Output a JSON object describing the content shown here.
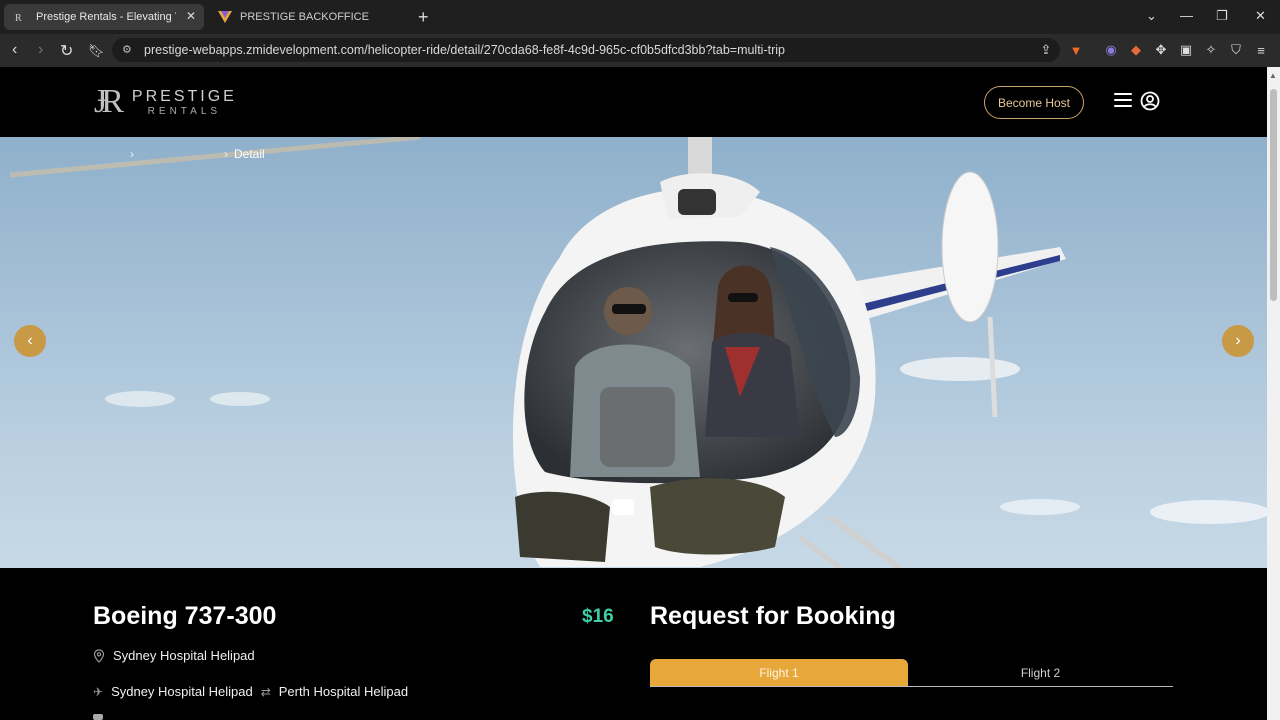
{
  "browser": {
    "tabs": [
      {
        "title": "Prestige Rentals - Elevating Your",
        "favicon": "pr-logo-icon",
        "active": true
      },
      {
        "title": "PRESTIGE BACKOFFICE",
        "favicon": "triangle-logo-icon",
        "active": false
      }
    ],
    "new_tab": "+",
    "url": "prestige-webapps.zmidevelopment.com/helicopter-ride/detail/270cda68-fe8f-4c9d-965c-cf0b5dfcd3bb?tab=multi-trip"
  },
  "header": {
    "logo_mark": "ɈR",
    "logo_word": "PRESTIGE",
    "logo_sub": "RENTALS",
    "become_host": "Become Host"
  },
  "hero": {
    "breadcrumb": {
      "current": "Detail"
    },
    "image": "helicopter-with-pilot-and-passenger"
  },
  "listing": {
    "title": "Boeing 737-300",
    "price": "$16",
    "location": "Sydney Hospital Helipad",
    "route_from": "Sydney Hospital Helipad",
    "route_to": "Perth Hospital Helipad"
  },
  "booking": {
    "title": "Request for Booking",
    "tabs": [
      "Flight 1",
      "Flight 2"
    ],
    "accent": "#e8a73b"
  },
  "colors": {
    "price": "#3fd0a6",
    "nav_arrows": "#c99a45",
    "host_border": "#c9a06a"
  }
}
